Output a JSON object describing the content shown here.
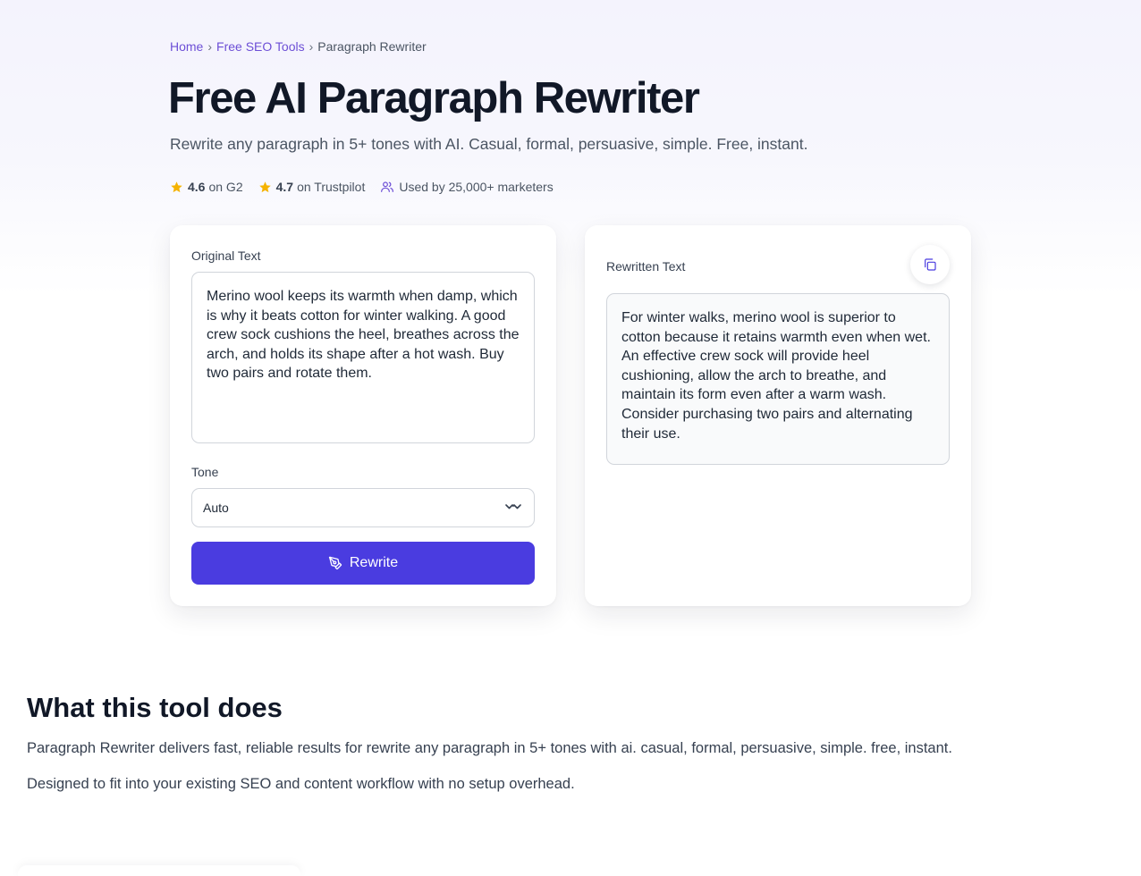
{
  "breadcrumb": {
    "home": "Home",
    "sep1": "›",
    "tools": "Free SEO Tools",
    "sep2": "›",
    "current": "Paragraph Rewriter"
  },
  "hero": {
    "title": "Free AI Paragraph Rewriter",
    "subtitle": "Rewrite any paragraph in 5+ tones with AI. Casual, formal, persuasive, simple. Free, instant."
  },
  "ratings": {
    "g2_score": "4.6",
    "g2_label": "on G2",
    "trustpilot_score": "4.7",
    "trustpilot_label": "on Trustpilot",
    "users": "Used by 25,000+ marketers",
    "star_color": "#f5b301"
  },
  "input_card": {
    "label": "Original Text",
    "text": "Merino wool keeps its warmth when damp, which is why it beats cotton for winter walking. A good crew sock cushions the heel, breathes across the arch, and holds its shape after a hot wash. Buy two pairs and rotate them.",
    "tone_label": "Tone",
    "tone_value": "Auto",
    "rewrite_button": "Rewrite",
    "button_color": "#4a3ce0"
  },
  "output_card": {
    "label": "Rewritten Text",
    "text": "For winter walks, merino wool is superior to cotton because it retains warmth even when wet. An effective crew sock will provide heel cushioning, allow the arch to breathe, and maintain its form even after a warm wash. Consider purchasing two pairs and alternating their use.",
    "copy_icon": "copy-icon"
  },
  "about": {
    "title": "What this tool does",
    "p1": "Paragraph Rewriter delivers fast, reliable results for rewrite any paragraph in 5+ tones with ai. casual, formal, persuasive, simple. free, instant.",
    "p2": "Designed to fit into your existing SEO and content workflow with no setup overhead."
  }
}
